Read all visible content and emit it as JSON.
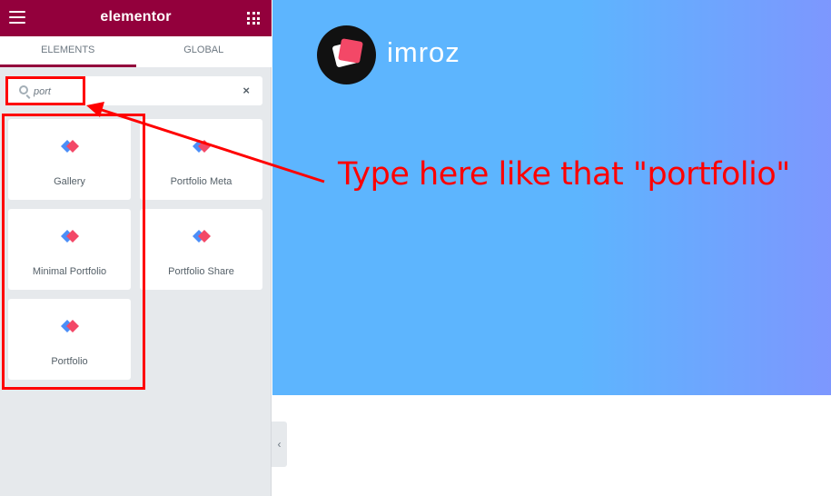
{
  "sidebar": {
    "logo": "elementor",
    "tabs": [
      {
        "label": "ELEMENTS",
        "active": true
      },
      {
        "label": "GLOBAL",
        "active": false
      }
    ],
    "search": {
      "value": "port",
      "clear_label": "×"
    },
    "widgets": [
      {
        "label": "Gallery"
      },
      {
        "label": "Portfolio Meta"
      },
      {
        "label": "Minimal Portfolio"
      },
      {
        "label": "Portfolio Share"
      },
      {
        "label": "Portfolio"
      }
    ],
    "collapse_label": "‹"
  },
  "preview": {
    "brand_name": "imroz"
  },
  "annotation": {
    "text": "Type here like that \"portfolio\""
  },
  "colors": {
    "brand": "#93003c",
    "panel": "#e6e9ec",
    "annotation": "#ff0000",
    "canvas_start": "#5db5fe",
    "canvas_end": "#7d97fe"
  }
}
